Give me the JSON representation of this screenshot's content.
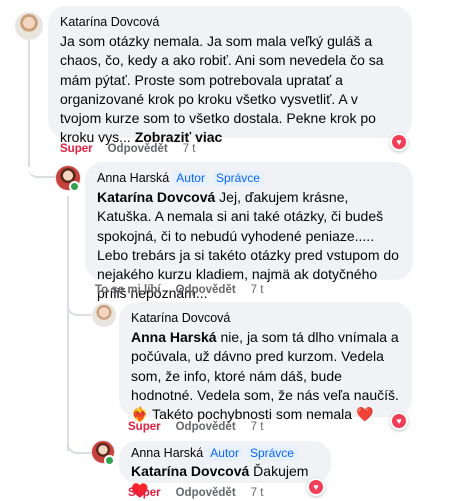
{
  "comments": [
    {
      "author": "Katarína Dovcová",
      "text": "Ja som otázky nemala. Ja som mala veľký guláš a chaos, čo, kedy a ako robiť. Ani som nevedela čo sa mám pýtať. Proste som potrebovala upratať a organizované krok po kroku všetko vysvetliť. A v tvojom kurze som to všetko dostala. Pekne krok po kroku vys...",
      "see_more": "Zobraziť viac",
      "reaction_label": "Super",
      "reply_label": "Odpovědět",
      "time": "7 t",
      "reaction_icon": "heart-reaction-icon"
    },
    {
      "author": "Anna Harská",
      "badges": [
        "Autor",
        "Správce"
      ],
      "mention": "Katarína Dovcová",
      "text": " Jej, ďakujem krásne, Katuška. A nemala si ani také otázky, či budeš spokojná, či to nebudú vyhodené peniaze..... Lebo trebárs ja si takéto otázky pred vstupom do nejakého kurzu kladiem, najmä ak dotyčného príliš nepoznám...",
      "reaction_label": "To se mi líbí",
      "reply_label": "Odpovědět",
      "time": "7 t"
    },
    {
      "author": "Katarína Dovcová",
      "mention": "Anna Harská",
      "text": " nie, ja som  tá dlho vnímala a počúvala, už dávno pred kurzom. Vedela som, že info, ktoré nám dáš, bude hodnotné. Vedela som, že nás veľa naučíš. ❤️‍🔥 Takéto pochybnosti som nemala",
      "reaction_label": "Super",
      "reply_label": "Odpovědět",
      "time": "7 t",
      "reaction_icon": "heart-reaction-icon"
    },
    {
      "author": "Anna Harská",
      "badges": [
        "Autor",
        "Správce"
      ],
      "mention": "Katarína Dovcová",
      "text": " Ďakujem",
      "reaction_label": "Super",
      "reply_label": "Odpovědět",
      "time": "7 t",
      "reaction_icon": "heart-reaction-icon"
    }
  ],
  "colors": {
    "bubble": "#f0f2f5",
    "badge_text": "#0866ff",
    "super_red": "#e41e3f",
    "secondary": "#65676b"
  }
}
